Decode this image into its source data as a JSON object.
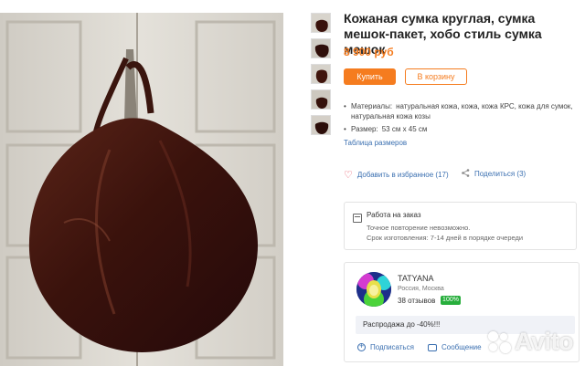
{
  "product": {
    "title": "Кожаная сумка круглая, сумка мешок-пакет, хобо стиль сумка мешок",
    "price": "8 900 руб",
    "buy_label": "Купить",
    "cart_label": "В корзину",
    "specs": [
      {
        "key": "Материалы:",
        "value": "натуральная кожа, кожа, кожа КРС, кожа для сумок, натуральная кожа козы"
      },
      {
        "key": "Размер:",
        "value": "53 см х 45 см"
      }
    ],
    "size_table_link": "Таблица размеров",
    "favorites_label": "Добавить в избранное (17)",
    "share_label": "Поделиться (3)"
  },
  "order": {
    "title": "Работа на заказ",
    "line1": "Точное повторение невозможно.",
    "line2": "Срок изготовления: 7-14 дней в порядке очереди"
  },
  "seller": {
    "name": "TATYANA",
    "location": "Россия, Москва",
    "reviews": "38 отзывов",
    "positive_pct": "100%",
    "promo": "Распродажа до -40%!!!",
    "subscribe_label": "Подписаться",
    "message_label": "Сообщение"
  },
  "watermark": "Avito",
  "colors": {
    "accent": "#f57c1f",
    "link": "#3a6fb0",
    "badge": "#27ae3c",
    "heart": "#e84b5e"
  }
}
